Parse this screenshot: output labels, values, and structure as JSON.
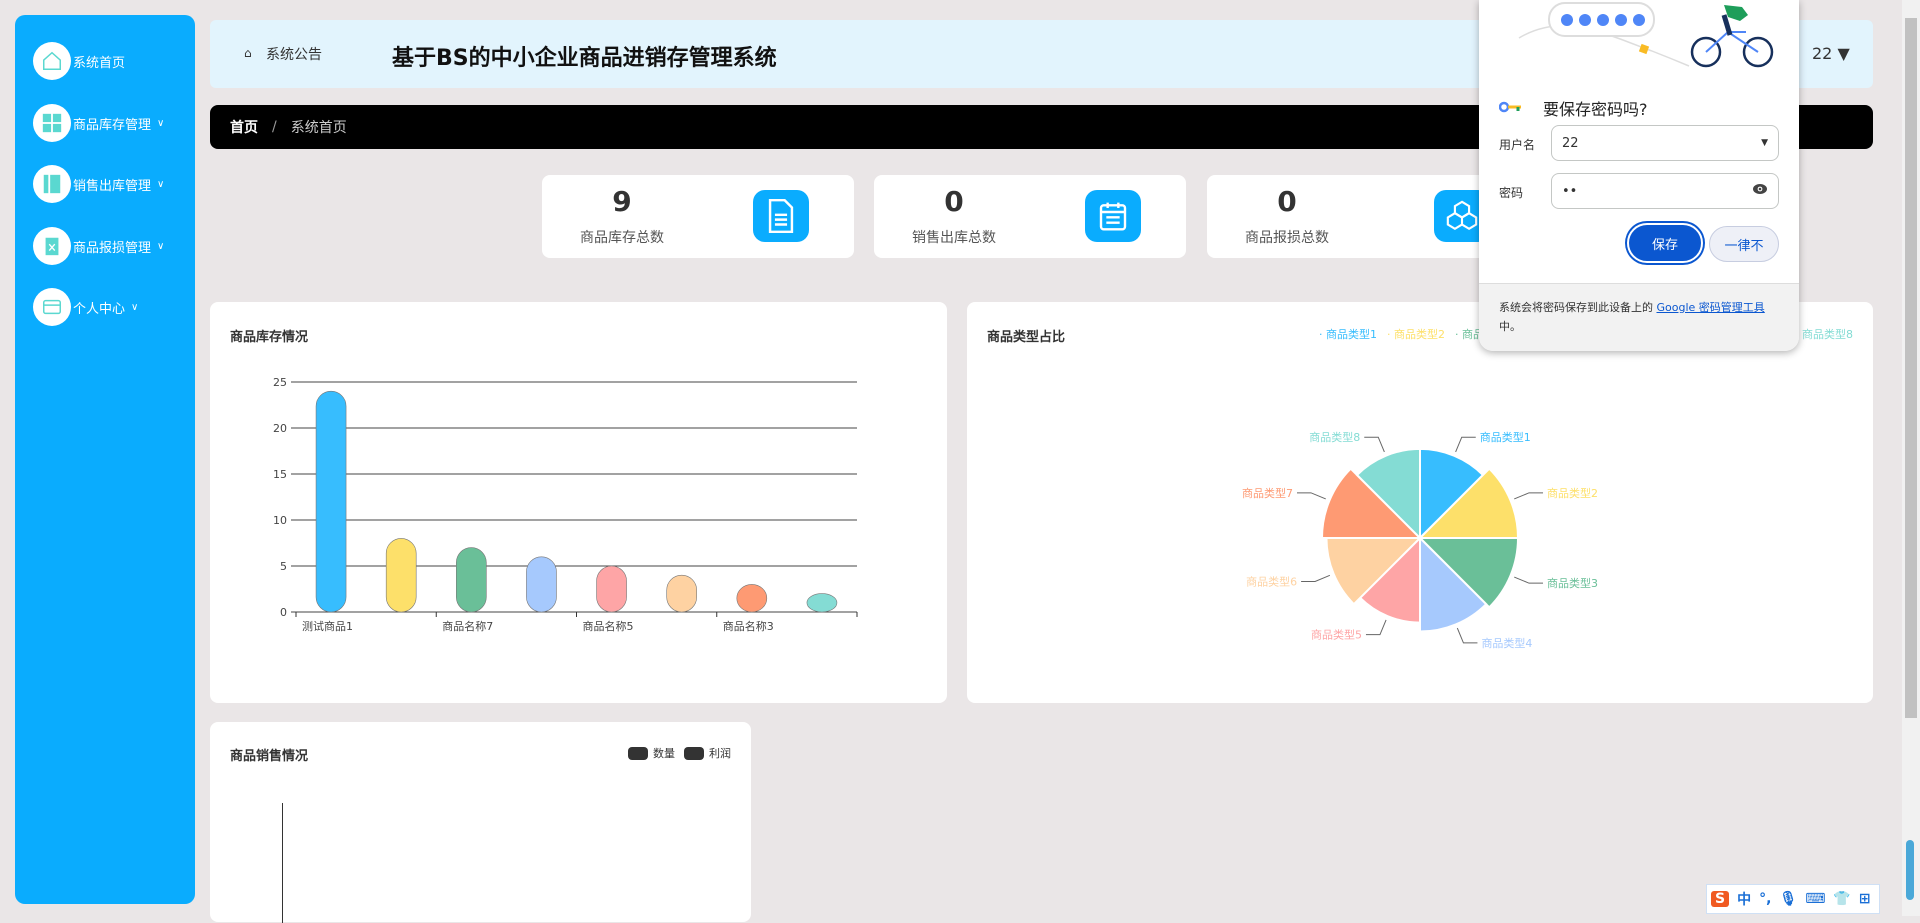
{
  "sidebar": {
    "items": [
      {
        "label": "系统首页",
        "icon": "home-icon",
        "expandable": false
      },
      {
        "label": "商品库存管理",
        "icon": "grid-icon",
        "expandable": true
      },
      {
        "label": "销售出库管理",
        "icon": "book-icon",
        "expandable": true
      },
      {
        "label": "商品报损管理",
        "icon": "clipboard-x-icon",
        "expandable": true
      },
      {
        "label": "个人中心",
        "icon": "wallet-icon",
        "expandable": true
      }
    ]
  },
  "header": {
    "notice": "系统公告",
    "title": "基于BS的中小企业商品进销存管理系统",
    "user": "22"
  },
  "breadcrumb": {
    "home": "首页",
    "sep": "/",
    "current": "系统首页"
  },
  "stats": [
    {
      "value": "9",
      "label": "商品库存总数",
      "icon": "document-icon"
    },
    {
      "value": "0",
      "label": "销售出库总数",
      "icon": "calendar-list-icon"
    },
    {
      "value": "0",
      "label": "商品报损总数",
      "icon": "cubes-icon"
    }
  ],
  "colors": [
    "#37bdfe",
    "#fde06a",
    "#6abf98",
    "#a6c9fd",
    "#fea5a6",
    "#fed2a2",
    "#fe9a73",
    "#84dcd4"
  ],
  "chart_data": [
    {
      "type": "bar",
      "title": "商品库存情况",
      "categories": [
        "测试商品1",
        "",
        "商品名称7",
        "",
        "商品名称5",
        "",
        "商品名称3",
        ""
      ],
      "values": [
        24,
        8,
        7,
        6,
        5,
        4,
        3,
        2
      ],
      "ylim": [
        0,
        25
      ],
      "yticks": [
        "0",
        "5",
        "10",
        "15",
        "20",
        "25"
      ],
      "grid": true
    },
    {
      "type": "pie",
      "rose": "area",
      "title": "商品类型占比",
      "categories": [
        "商品类型1",
        "商品类型2",
        "商品类型3",
        "商品类型4",
        "商品类型5",
        "商品类型6",
        "商品类型7",
        "商品类型8"
      ],
      "values": [
        20,
        22,
        22,
        21,
        19,
        21,
        22,
        20
      ],
      "legend": "top-right"
    },
    {
      "type": "bar",
      "title": "商品销售情况",
      "legend": [
        "数量",
        "利润"
      ],
      "categories": [],
      "series": [
        {
          "name": "数量",
          "values": []
        },
        {
          "name": "利润",
          "values": []
        }
      ]
    }
  ],
  "dialog": {
    "title": "要保存密码吗?",
    "username_label": "用户名",
    "username": "22",
    "password_label": "密码",
    "password": "••",
    "save": "保存",
    "never": "一律不",
    "footer": "系统会将密码保存到此设备上的 ",
    "footer_link": "Google 密码管理工具",
    "footer_end": "中。"
  },
  "ime": {
    "logo": "S",
    "mode": "中",
    "punct": "°,"
  }
}
